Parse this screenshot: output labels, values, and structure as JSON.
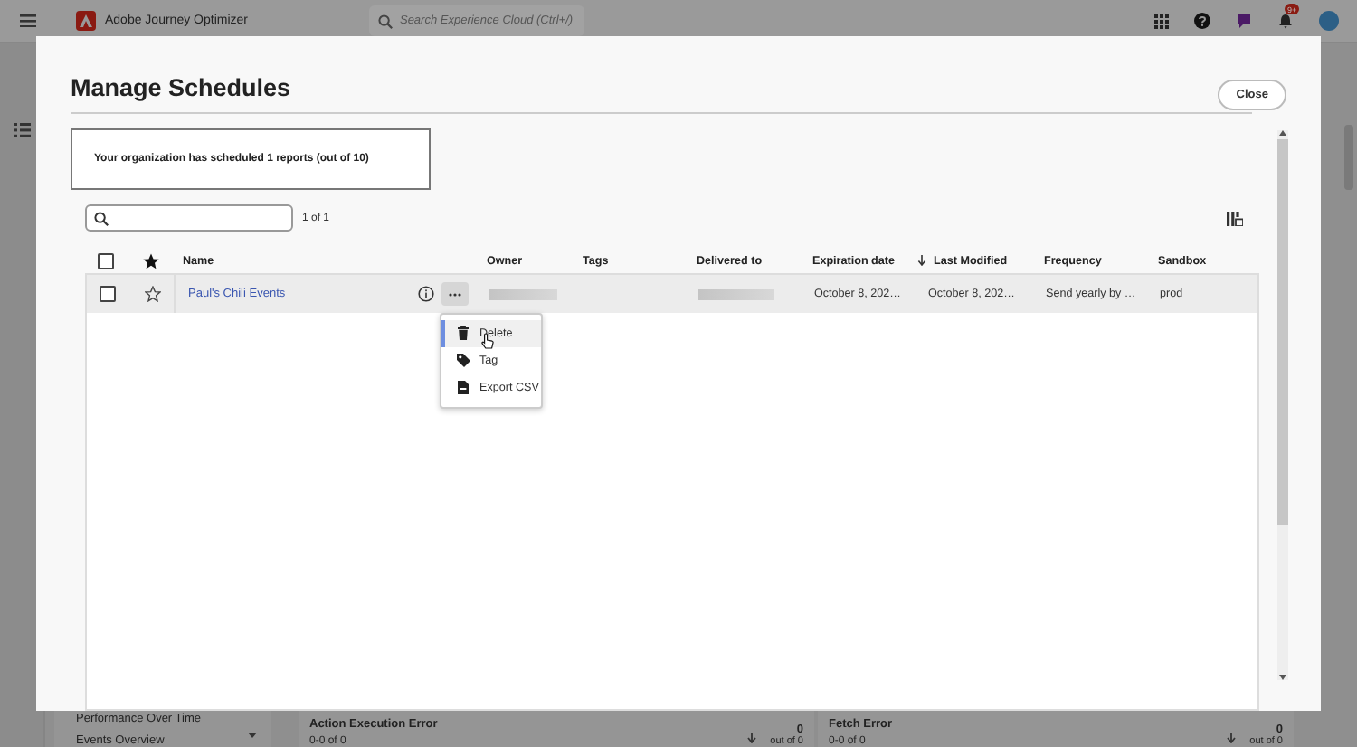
{
  "header": {
    "app_name": "Adobe Journey Optimizer",
    "search": {
      "placeholder": "Search Experience Cloud (Ctrl+/)"
    },
    "notification_badge": "9+"
  },
  "background": {
    "side_items": [
      "Performance Over Time",
      "Events Overview"
    ],
    "cards": [
      {
        "title": "Action Execution Error",
        "range": "0-0 of 0",
        "count": "0",
        "total": "out of 0"
      },
      {
        "title": "Fetch Error",
        "range": "0-0 of 0",
        "count": "0",
        "total": "out of 0"
      }
    ]
  },
  "dialog": {
    "title": "Manage Schedules",
    "close_button": "Close",
    "notice": "Your organization has scheduled 1 reports (out of 10)",
    "page_count": "1 of 1",
    "table": {
      "select_all": {
        "checked": false
      },
      "columns": [
        {
          "label": "Name",
          "sorted": false
        },
        {
          "label": "Owner",
          "sorted": false
        },
        {
          "label": "Tags",
          "sorted": false
        },
        {
          "label": "Delivered to",
          "sorted": false
        },
        {
          "label": "Expiration date",
          "sorted": false
        },
        {
          "label": "Last Modified",
          "sorted": true
        },
        {
          "label": "Frequency",
          "sorted": false
        },
        {
          "label": "Sandbox",
          "sorted": false
        }
      ],
      "rows": [
        {
          "checked": false,
          "starred": false,
          "name": "Paul's Chili Events",
          "expiration": "October 8, 202…",
          "last_modified": "October 8, 202…",
          "frequency": "Send yearly by …",
          "sandbox": "prod"
        }
      ]
    },
    "menu": [
      {
        "kind": "trash",
        "label": "Delete",
        "selected": true
      },
      {
        "kind": "tag",
        "label": "Tag",
        "selected": false
      },
      {
        "kind": "file",
        "label": "Export CSV",
        "selected": false
      }
    ]
  }
}
